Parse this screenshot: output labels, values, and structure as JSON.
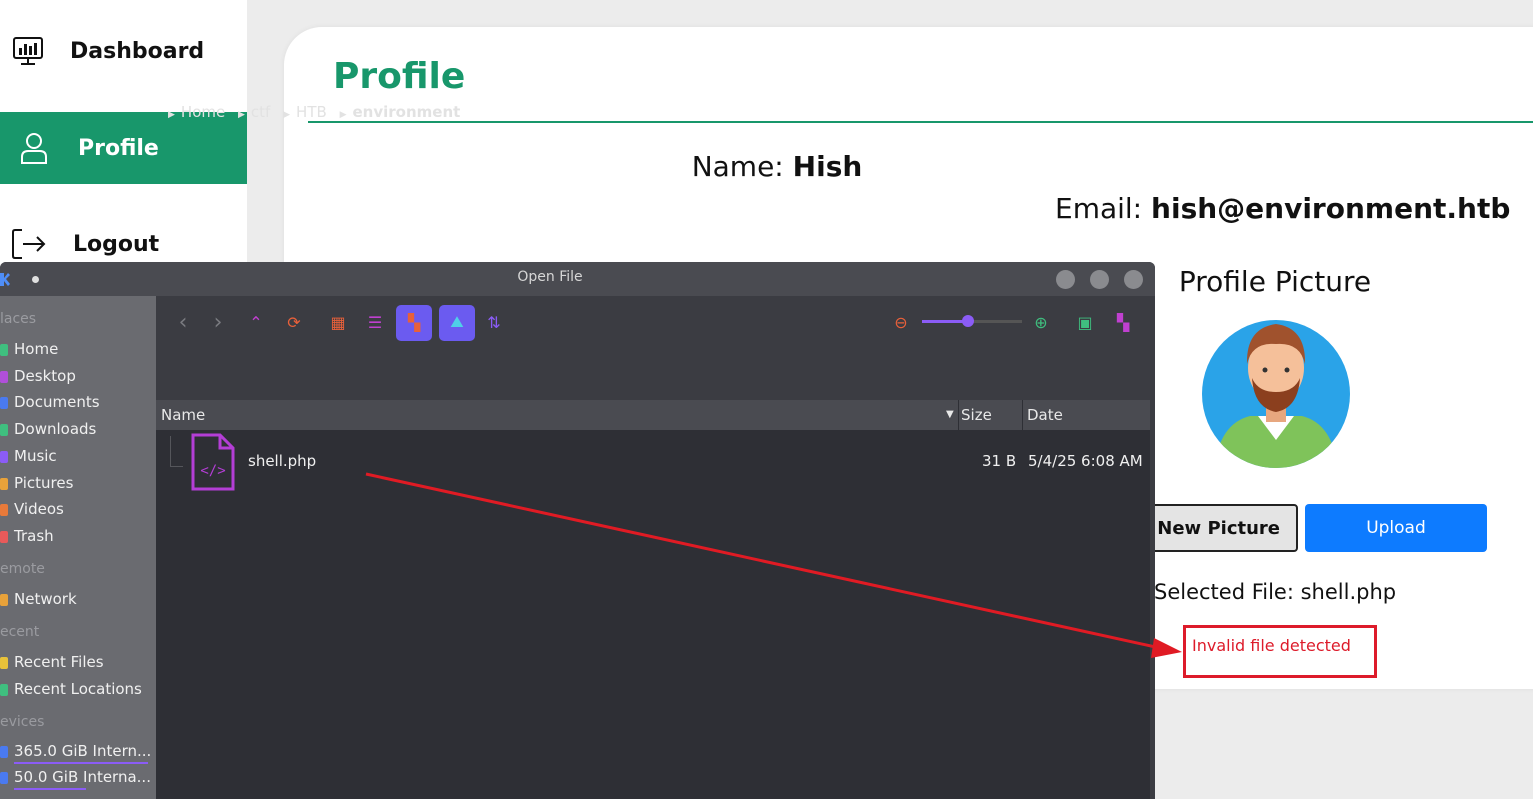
{
  "sidebar": {
    "items": [
      {
        "label": "Dashboard",
        "icon": "dashboard-monitor-icon"
      },
      {
        "label": "Profile",
        "icon": "user-icon",
        "active": true
      },
      {
        "label": "Logout",
        "icon": "logout-icon"
      }
    ]
  },
  "profile": {
    "title": "Profile",
    "name_label": "Name:",
    "name_value": "Hish",
    "email_label": "Email:",
    "email_value": "hish@environment.htb",
    "picture_title": "Profile Picture",
    "choose_label": "e New Picture",
    "upload_label": "Upload",
    "selected_file": "Selected File: shell.php",
    "error": "Invalid file detected"
  },
  "dialog": {
    "title": "Open File",
    "places_heading": "laces",
    "places": [
      "Home",
      "Desktop",
      "Documents",
      "Downloads",
      "Music",
      "Pictures",
      "Videos",
      "Trash"
    ],
    "remote_heading": "emote",
    "remote": [
      "Network"
    ],
    "recent_heading": "ecent",
    "recent": [
      "Recent Files",
      "Recent Locations"
    ],
    "devices_heading": "evices",
    "devices": [
      "365.0 GiB Intern...",
      "50.0 GiB Interna..."
    ],
    "breadcrumb": [
      "Home",
      "ctf",
      "HTB",
      "environment"
    ],
    "columns": {
      "name": "Name",
      "size": "Size",
      "date": "Date"
    },
    "file": {
      "name": "shell.php",
      "size": "31 B",
      "date": "5/4/25 6:08 AM",
      "icon": "php-code-file-icon"
    }
  },
  "colors": {
    "brand_green": "#18976b",
    "upload_blue": "#0d7bff",
    "error_red": "#dd1b2a",
    "accent_purple": "#8b5cf6"
  }
}
